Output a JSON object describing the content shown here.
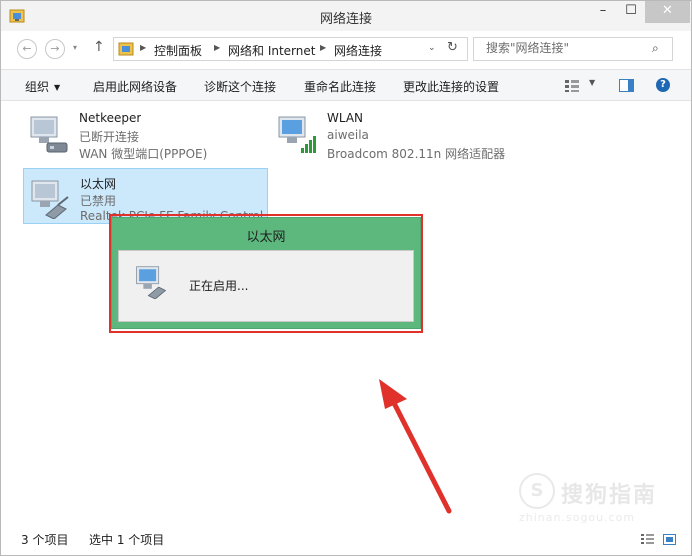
{
  "window": {
    "title": "网络连接",
    "min_label": "–",
    "max_label": "☐",
    "close_label": "✕"
  },
  "address": {
    "back": "←",
    "forward": "→",
    "recent": "▾",
    "up": "↑",
    "breadcrumb": [
      "控制面板",
      "网络和 Internet",
      "网络连接"
    ],
    "dropdown": "⌄",
    "refresh": "↻",
    "search_placeholder": "搜索\"网络连接\"",
    "search_glyph": "⌕"
  },
  "commands": {
    "organize": "组织",
    "enable_device": "启用此网络设备",
    "diagnose": "诊断这个连接",
    "rename": "重命名此连接",
    "change_settings": "更改此连接的设置",
    "caret": "▼"
  },
  "connections": [
    {
      "name": "Netkeeper",
      "status": "已断开连接",
      "device": "WAN 微型端口(PPPOE)",
      "icon": "wan-miniport-icon"
    },
    {
      "name": "WLAN",
      "status": "aiweila",
      "device": "Broadcom 802.11n 网络适配器",
      "icon": "wlan-signal-icon"
    },
    {
      "name": "以太网",
      "status": "已禁用",
      "device": "Realtek PCIe FE Family Control",
      "icon": "ethernet-cable-icon",
      "selected": true
    }
  ],
  "dialog": {
    "title": "以太网",
    "message": "正在启用..."
  },
  "watermark": {
    "logo": "S",
    "text": "搜狗指南",
    "url": "zhinan.sogou.com"
  },
  "statusbar": {
    "item_count": "3 个项目",
    "selected_count": "选中 1 个项目"
  },
  "colors": {
    "dialog_green": "#5cb87d",
    "highlight_red": "#e0312b",
    "selection_blue": "#cce8fb"
  }
}
